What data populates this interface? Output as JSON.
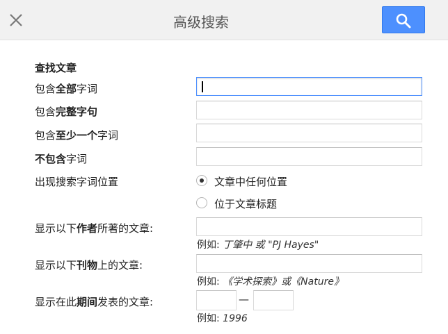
{
  "header": {
    "title": "高级搜索",
    "close_icon": "close-icon",
    "search_icon": "search-icon",
    "accent_color": "#4d90fe"
  },
  "form": {
    "section_title": "查找文章",
    "all_words": {
      "pre": "包含",
      "bold": "全部",
      "post": "字词",
      "value": ""
    },
    "exact_phrase": {
      "pre": "包含",
      "bold": "完整字句",
      "post": "",
      "value": ""
    },
    "at_least_one": {
      "pre": "包含",
      "bold": "至少一个",
      "post": "字词",
      "value": ""
    },
    "without": {
      "pre": "",
      "bold": "不包含",
      "post": "字词",
      "value": ""
    },
    "occurrence": {
      "label": "出现搜索字词位置",
      "options": [
        {
          "label": "文章中任何位置",
          "checked": true
        },
        {
          "label": "位于文章标题",
          "checked": false
        }
      ]
    },
    "author": {
      "pre": "显示以下",
      "bold": "作者",
      "post": "所著的文章:",
      "hint_prefix": "例如:",
      "hint_example": "丁肇中 或 \"PJ Hayes\""
    },
    "publication": {
      "pre": "显示以下",
      "bold": "刊物",
      "post": "上的文章:",
      "hint_prefix": "例如:",
      "hint_example": "《学术探索》或《Nature》"
    },
    "date": {
      "pre": "显示在此",
      "bold": "期间",
      "post": "发表的文章:",
      "dash": "—",
      "hint_prefix": "例如:",
      "hint_example": "1996"
    }
  }
}
